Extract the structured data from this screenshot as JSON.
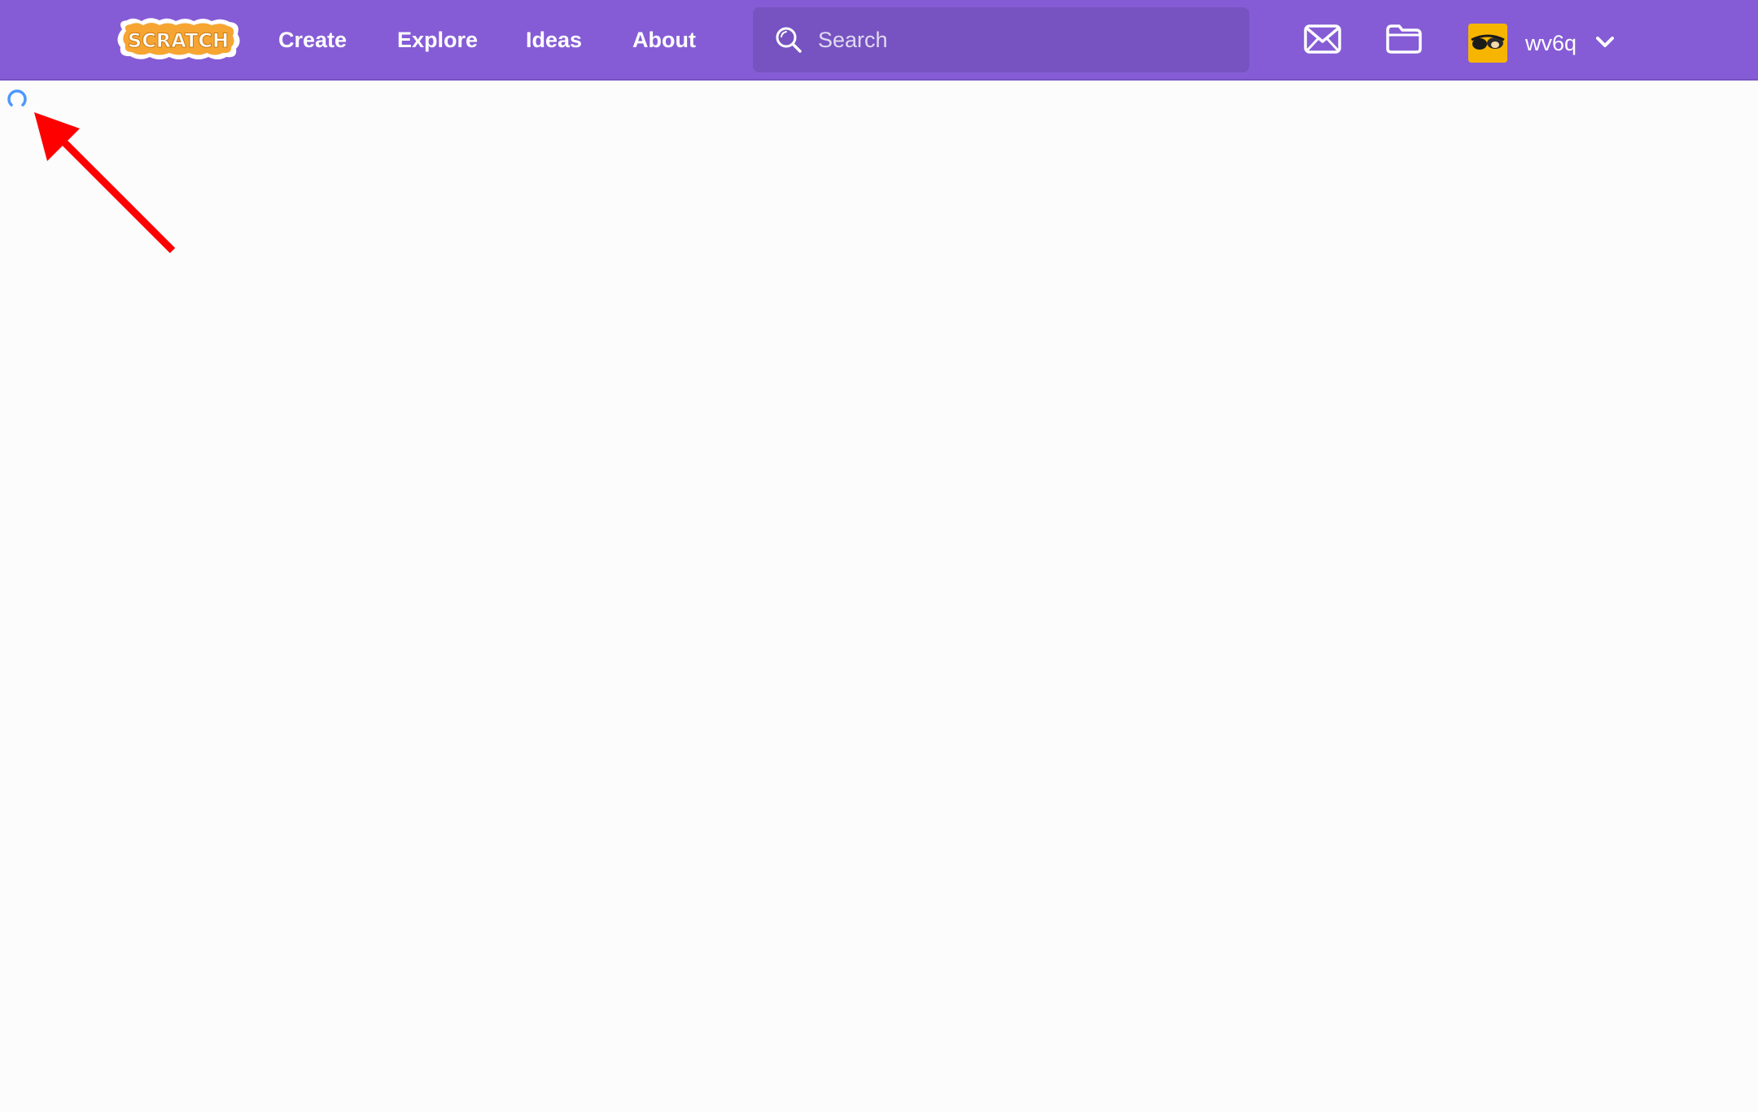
{
  "header": {
    "logo_text": "SCRATCH",
    "nav": [
      {
        "label": "Create"
      },
      {
        "label": "Explore"
      },
      {
        "label": "Ideas"
      },
      {
        "label": "About"
      }
    ],
    "search": {
      "placeholder": "Search",
      "value": ""
    },
    "messages_icon": "envelope-icon",
    "projects_icon": "folder-icon",
    "account": {
      "username": "wv6q",
      "menu_icon": "chevron-down-icon"
    }
  },
  "content": {
    "status": "loading",
    "spinner_icon": "loading-spinner-icon",
    "annotation_icon": "red-arrow-icon"
  },
  "colors": {
    "header_bg": "#855cd6",
    "search_bg": "#7653c1",
    "page_bg": "#fcfcfc",
    "spinner": "#4c97ff",
    "annotation": "#ff0000",
    "logo_orange": "#f7a532"
  }
}
